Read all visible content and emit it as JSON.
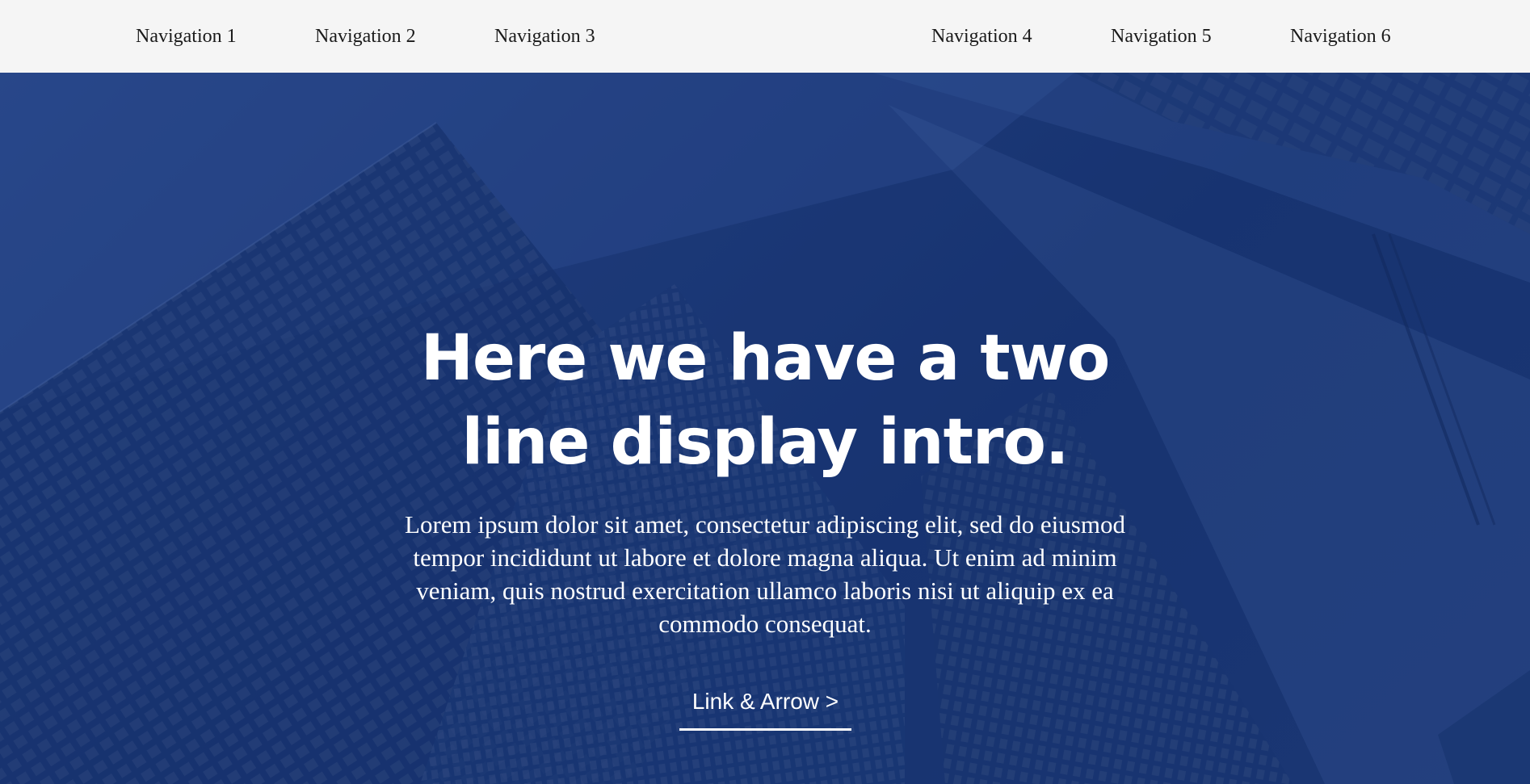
{
  "nav": {
    "items": [
      {
        "label": "Navigation 1"
      },
      {
        "label": "Navigation 2"
      },
      {
        "label": "Navigation 3"
      },
      {
        "label": "Navigation 4"
      },
      {
        "label": "Navigation 5"
      },
      {
        "label": "Navigation 6"
      }
    ]
  },
  "hero": {
    "title": "Here we have a two line display intro.",
    "body": "Lorem ipsum dolor sit amet, consectetur adipiscing elit, sed do eiusmod tempor incididunt ut labore et dolore magna aliqua. Ut enim ad minim veniam, quis nostrud exercitation ullamco laboris nisi ut aliquip ex ea commodo consequat.",
    "cta_label": "Link & Arrow >",
    "background_image": "skyscrapers-photo"
  },
  "colors": {
    "nav_background": "#f5f5f5",
    "nav_text": "#1a1a1a",
    "hero_overlay": "#1a3570",
    "hero_text": "#ffffff"
  }
}
